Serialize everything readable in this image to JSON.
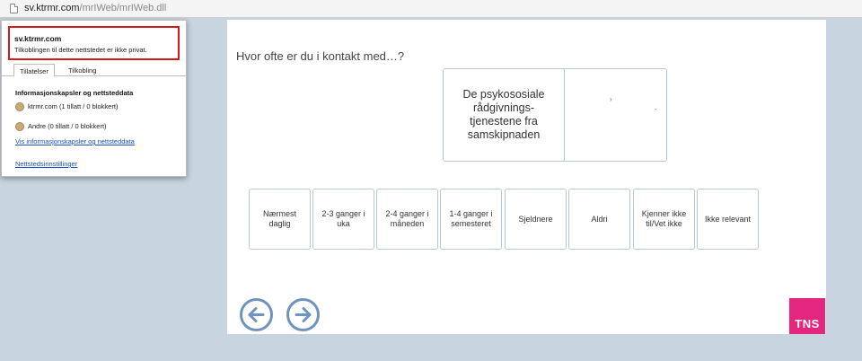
{
  "browser": {
    "url_host": "sv.ktrmr.com",
    "url_path": "/mrIWeb/mrIWeb.dll"
  },
  "site_info": {
    "site": "sv.ktrmr.com",
    "message": "Tilkoblingen til dette nettstedet er ikke privat.",
    "tabs": [
      {
        "label": "Tillatelser",
        "active": true
      },
      {
        "label": "Tilkobling",
        "active": false
      }
    ],
    "section_title": "Informasjonskapsler og nettsteddata",
    "cookies": [
      {
        "label": "ktrmr.com (1 tillatt / 0 blokkert)"
      },
      {
        "label": "Andre (0 tillatt / 0 blokkert)"
      }
    ],
    "view_cookies_link": "Vis informasjonskapsler og nettsteddata",
    "settings_link": "Nettstedsinnstillinger",
    "colors": {
      "highlight_border": "#d41b1b",
      "link": "#1a4fbf"
    }
  },
  "survey": {
    "question": "Hvor ofte er du i kontakt med…?",
    "card_text": "De psykososiale rådgivnings-tjenestene fra samskipnaden",
    "answers": [
      {
        "label": "Nærmest daglig"
      },
      {
        "label": "2-3 ganger i uka"
      },
      {
        "label": "2-4 ganger i måneden"
      },
      {
        "label": "1-4 ganger i semesteret"
      },
      {
        "label": "Sjeldnere"
      },
      {
        "label": "Aldri"
      },
      {
        "label": "Kjenner ikke til/Vet ikke"
      },
      {
        "label": "Ikke relevant"
      }
    ],
    "nav": {
      "back_icon": "arrow-left-circle-icon",
      "next_icon": "arrow-right-circle-icon"
    },
    "brand": {
      "label": "TNS",
      "color": "#e4277e"
    },
    "colors": {
      "accent": "#6f93bf",
      "border": "#b8cad8",
      "background": "#c8d4e0"
    }
  }
}
